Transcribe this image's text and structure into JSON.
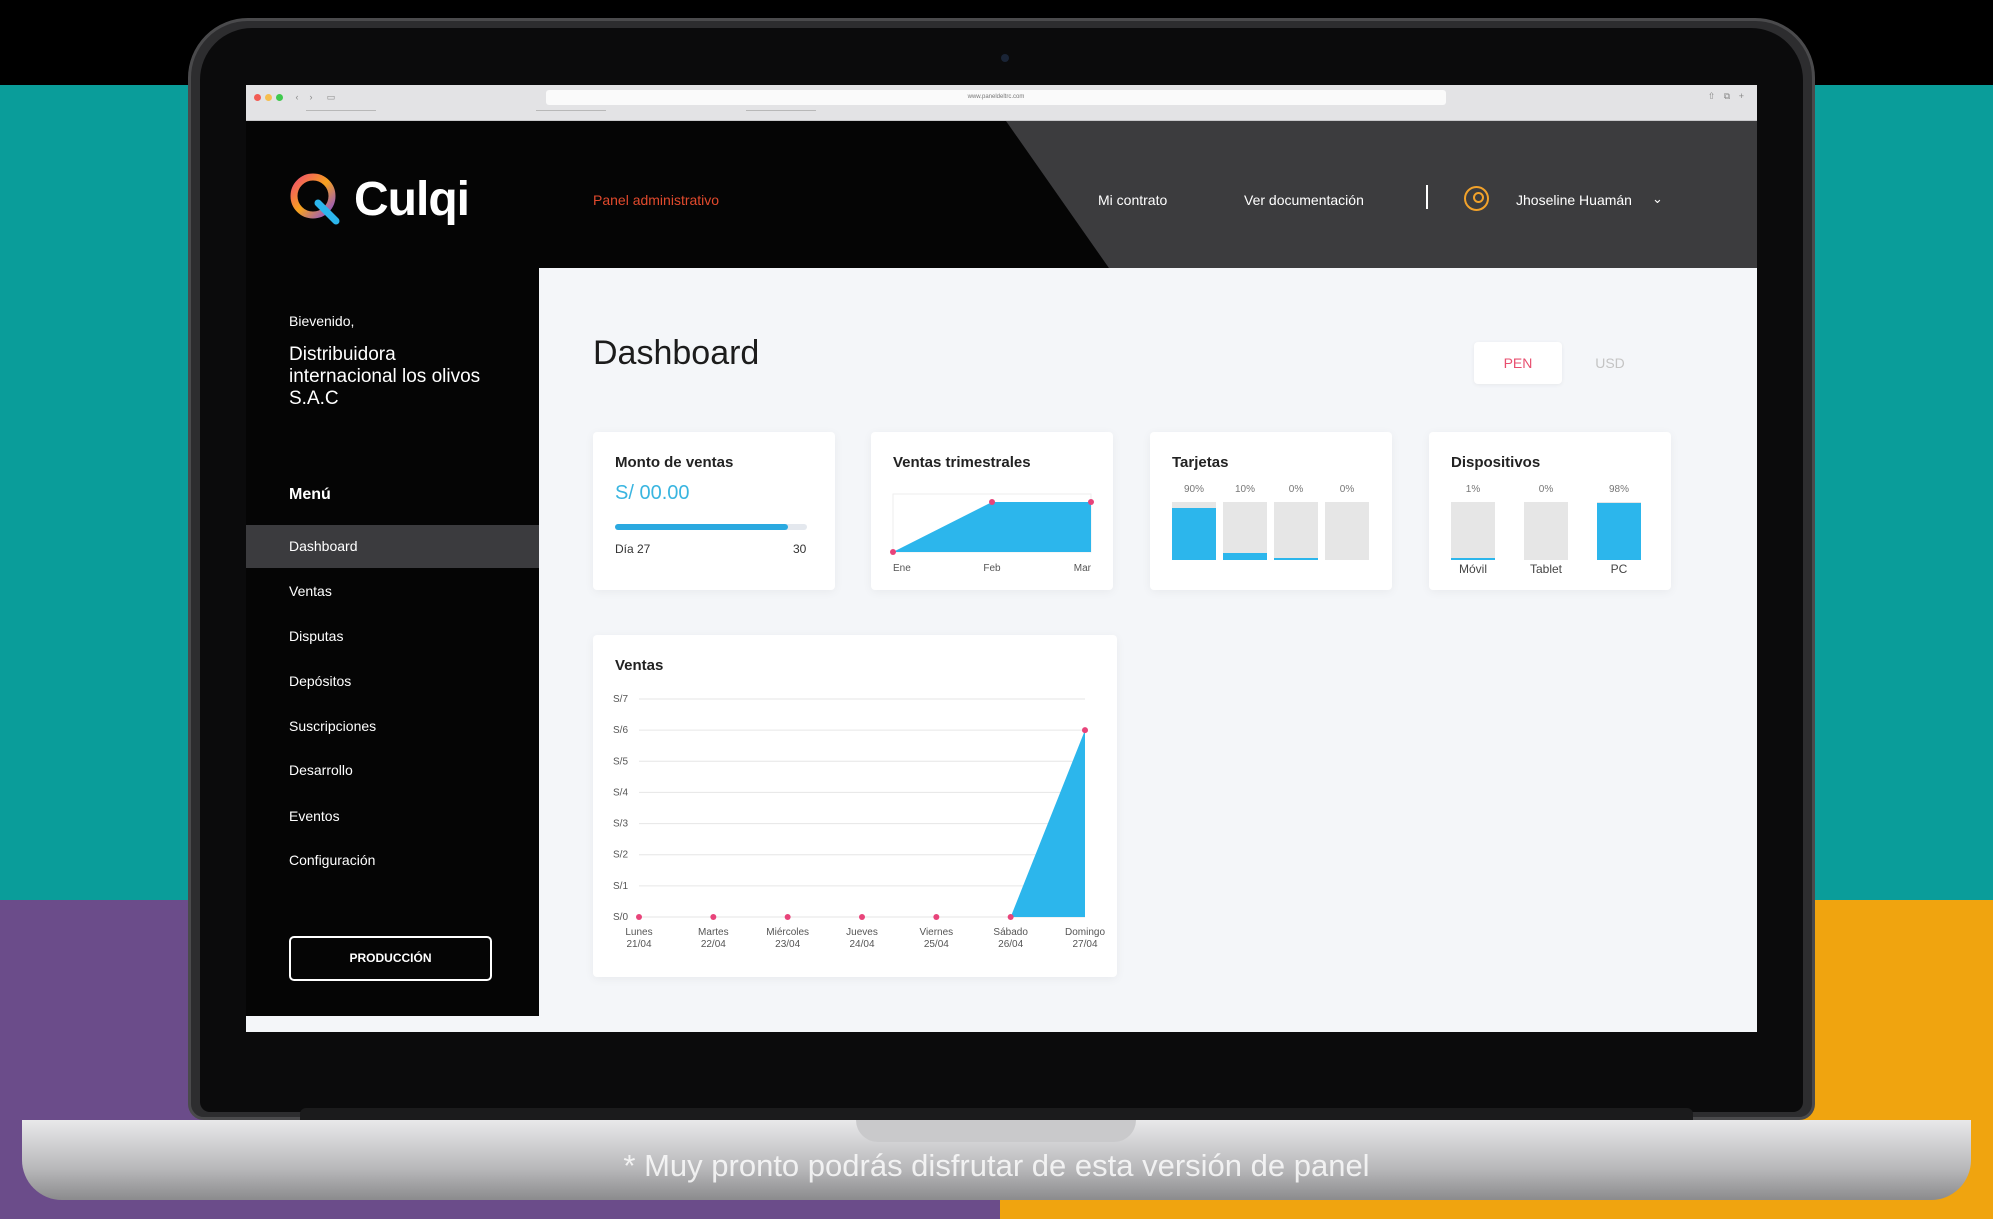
{
  "browser": {
    "url": "www.paneldeltrc.com"
  },
  "header": {
    "brand": "Culqi",
    "panel_link": "Panel administrativo",
    "nav": [
      "Mi contrato",
      "Ver documentación"
    ],
    "user_name": "Jhoseline Huamán",
    "user_chevron": "⌄"
  },
  "sidebar": {
    "welcome": "Bievenido,",
    "company": "Distribuidora internacional los olivos S.A.C",
    "menu_title": "Menú",
    "items": [
      {
        "label": "Dashboard",
        "active": true
      },
      {
        "label": "Ventas"
      },
      {
        "label": "Disputas"
      },
      {
        "label": "Depósitos"
      },
      {
        "label": "Suscripciones"
      },
      {
        "label": "Desarrollo"
      },
      {
        "label": "Eventos"
      },
      {
        "label": "Configuración"
      }
    ],
    "production_button": "PRODUCCIÓN"
  },
  "main": {
    "title": "Dashboard",
    "currencies": [
      "PEN",
      "USD"
    ],
    "selected_currency": "PEN"
  },
  "cards": {
    "monto": {
      "title": "Monto de ventas",
      "amount": "S/ 00.00",
      "progress_fraction": 0.9,
      "progress_start_label": "Día 27",
      "progress_end_label": "30"
    },
    "trimestrales": {
      "title": "Ventas trimestrales",
      "categories": [
        "Ene",
        "Feb",
        "Mar"
      ],
      "values": [
        0,
        1,
        1
      ]
    },
    "tarjetas": {
      "title": "Tarjetas",
      "bars": [
        {
          "pct": "90%",
          "fraction": 0.9
        },
        {
          "pct": "10%",
          "fraction": 0.12
        },
        {
          "pct": "0%",
          "fraction": 0.04
        },
        {
          "pct": "0%",
          "fraction": 0
        }
      ]
    },
    "dispositivos": {
      "title": "Dispositivos",
      "bars": [
        {
          "pct": "1%",
          "label": "Móvil",
          "fraction": 0.04
        },
        {
          "pct": "0%",
          "label": "Tablet",
          "fraction": 0
        },
        {
          "pct": "98%",
          "label": "PC",
          "fraction": 0.98
        }
      ]
    },
    "ventas": {
      "title": "Ventas"
    }
  },
  "chart_data": {
    "type": "area",
    "title": "Ventas",
    "categories": [
      [
        "Lunes",
        "21/04"
      ],
      [
        "Martes",
        "22/04"
      ],
      [
        "Miércoles",
        "23/04"
      ],
      [
        "Jueves",
        "24/04"
      ],
      [
        "Viernes",
        "25/04"
      ],
      [
        "Sábado",
        "26/04"
      ],
      [
        "Domingo",
        "27/04"
      ]
    ],
    "y_ticks": [
      "S/0",
      "S/1",
      "S/2",
      "S/3",
      "S/4",
      "S/5",
      "S/6",
      "S/7"
    ],
    "values": [
      0,
      0,
      0,
      0,
      0,
      0,
      6
    ],
    "ylim": [
      0,
      7
    ],
    "grid": true
  },
  "footer_note": "* Muy pronto podrás disfrutar de esta versión de panel",
  "colors": {
    "accent_blue": "#2cb6ec",
    "point_pink": "#e8447a",
    "panel_link": "#e24a2d",
    "user_icon": "#f2a22a"
  }
}
